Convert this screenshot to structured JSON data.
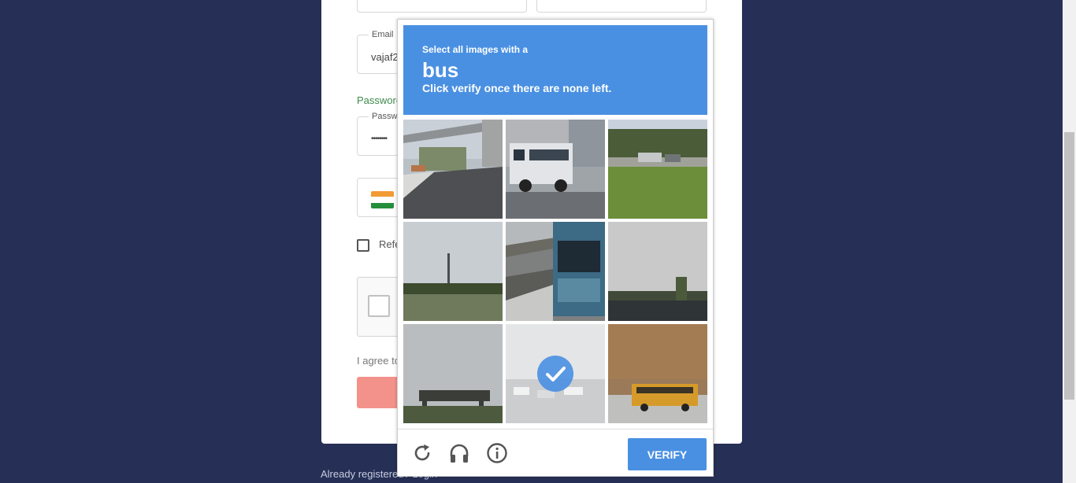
{
  "form": {
    "email_label": "Email",
    "email_value": "vajaf2",
    "password_hint": "Passworc",
    "password_label": "Passwo",
    "password_value": "••••••••",
    "referral_label": "Refe",
    "agree_text": "I agree to",
    "already_text": "Already registered? Login"
  },
  "challenge": {
    "line1": "Select all images with a",
    "target": "bus",
    "line2": "Click verify once there are none left.",
    "tiles": [
      {
        "name": "tile-overpass-road",
        "selected": false
      },
      {
        "name": "tile-white-bus",
        "selected": false
      },
      {
        "name": "tile-trucks-grass",
        "selected": false
      },
      {
        "name": "tile-pole-sky",
        "selected": false
      },
      {
        "name": "tile-bus-station",
        "selected": false
      },
      {
        "name": "tile-trees-sky",
        "selected": false
      },
      {
        "name": "tile-bridge",
        "selected": false
      },
      {
        "name": "tile-parking-lot",
        "selected": true
      },
      {
        "name": "tile-school-bus",
        "selected": false
      }
    ],
    "verify_label": "VERIFY",
    "icons": [
      "reload-icon",
      "headphones-icon",
      "info-icon"
    ]
  },
  "colors": {
    "page_bg": "#263056",
    "accent": "#4a90e2",
    "submit": "#f3928a"
  }
}
